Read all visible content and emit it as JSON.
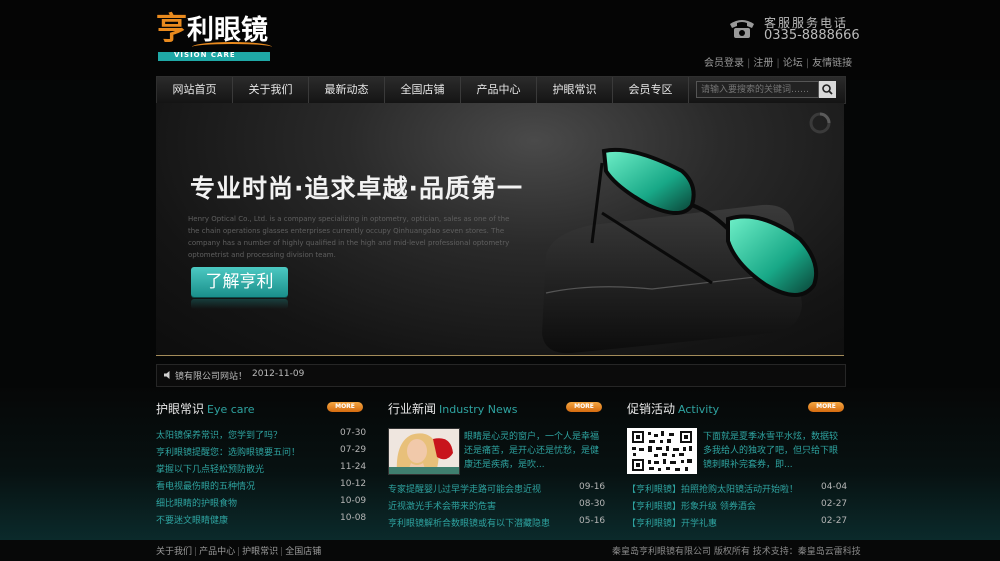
{
  "colors": {
    "accent": "#2ea3a0",
    "more_button": "#e88a22",
    "background": "#050606",
    "logo_orange": "#e98a1e"
  },
  "logo": {
    "cn_first": "亨",
    "cn_rest": "利眼镜",
    "en": "VISION  CARE"
  },
  "contact": {
    "label": "客服服务电话",
    "phone": "0335-8888666",
    "icon": "telephone-icon"
  },
  "top_links": [
    "会员登录",
    "注册",
    "论坛",
    "友情链接"
  ],
  "nav": {
    "items": [
      "网站首页",
      "关于我们",
      "最新动态",
      "全国店铺",
      "产品中心",
      "护眼常识",
      "会员专区"
    ]
  },
  "search": {
    "placeholder": "请输入要搜索的关键词……",
    "icon": "search-icon"
  },
  "banner": {
    "title": "专业时尚·追求卓越·品质第一",
    "description": "Henry Optical Co., Ltd. is a company specializing in optometry, optician, sales as one of the the chain operations glasses enterprises currently occupy Qinhuangdao seven stores. The company has a number of highly qualified in the high and mid-level professional optometry optometrist and processing division team.",
    "button": "了解亨利"
  },
  "ticker": {
    "text": "镜有限公司网站！",
    "date": "2012-11-09",
    "icon": "speaker-icon"
  },
  "more_label": "MORE",
  "eye_care": {
    "title": "护眼常识",
    "title_en": "Eye care",
    "items": [
      {
        "text": "太阳镜保养常识，您学到了吗？",
        "date": "07-30"
      },
      {
        "text": "亨利眼镜提醒您：选购眼镜要五问！",
        "date": "07-29"
      },
      {
        "text": "掌握以下几点轻松预防散光",
        "date": "11-24"
      },
      {
        "text": "看电视最伤眼的五种情况",
        "date": "10-12"
      },
      {
        "text": "细比眼睛的护眼食物",
        "date": "10-09"
      },
      {
        "text": "不要迷文眼睛健康",
        "date": "10-08"
      }
    ]
  },
  "industry_news": {
    "title": "行业新闻",
    "title_en": "Industry News",
    "intro": "眼睛是心灵的窗户，一个人是幸福还是痛苦，是开心还是忧愁，是健康还是疾病，是吹...",
    "items": [
      {
        "text": "专家提醒婴儿过早学走路可能会患近视",
        "date": "09-16"
      },
      {
        "text": "近视激光手术会带来的危害",
        "date": "08-30"
      },
      {
        "text": "亨利眼镜解析合数眼镜或有以下潜藏隐患",
        "date": "05-16"
      }
    ]
  },
  "promotions": {
    "title": "促销活动",
    "title_en": "Activity",
    "intro": "下面就是夏季冰雪平水炫，数据较多我给人的独攻了吧，但只给下眼镜刺眼补完套券，即...",
    "items": [
      {
        "text": "【亨利眼镜】拍照抢购太阳镜活动开始啦！",
        "date": "04-04"
      },
      {
        "text": "【亨利眼镜】形象升级 领券酒会",
        "date": "02-27"
      },
      {
        "text": "【亨利眼镜】开学礼惠",
        "date": "02-27"
      }
    ]
  },
  "footer": {
    "links": [
      "关于我们",
      "产品中心",
      "护眼常识",
      "全国店铺"
    ],
    "copyright": "秦皇岛亨利眼镜有限公司 版权所有 技术支持：秦皇岛云雷科技"
  }
}
